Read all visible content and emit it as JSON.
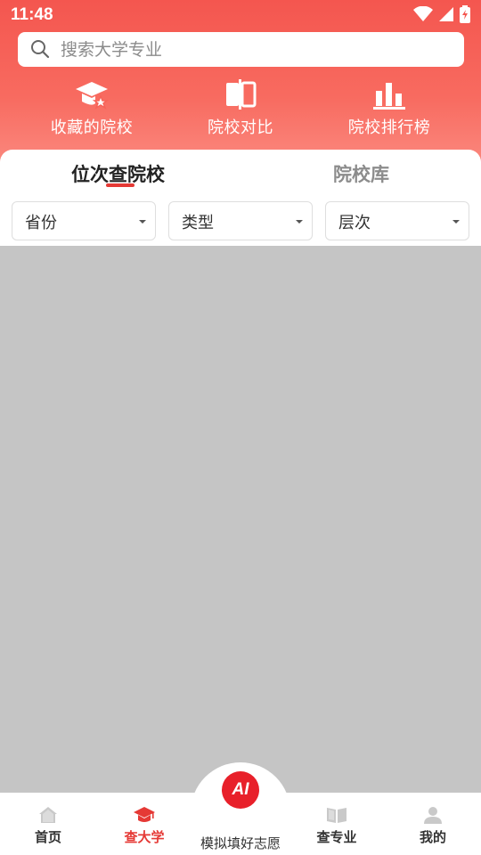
{
  "status_bar": {
    "time": "11:48"
  },
  "search": {
    "placeholder": "搜索大学专业",
    "value": ""
  },
  "quick_actions": [
    {
      "label": "收藏的院校",
      "icon": "graduation-star-icon"
    },
    {
      "label": "院校对比",
      "icon": "compare-icon"
    },
    {
      "label": "院校排行榜",
      "icon": "bar-ranking-icon"
    }
  ],
  "tabs": [
    {
      "label": "位次查院校",
      "active": true
    },
    {
      "label": "院校库",
      "active": false
    }
  ],
  "filters": [
    {
      "label": "省份"
    },
    {
      "label": "类型"
    },
    {
      "label": "层次"
    }
  ],
  "bottom_nav": {
    "items": [
      {
        "label": "首页",
        "icon": "home-icon",
        "active": false
      },
      {
        "label": "查大学",
        "icon": "graduation-cap-icon",
        "active": true
      },
      {
        "label": "查专业",
        "icon": "book-icon",
        "active": false
      },
      {
        "label": "我的",
        "icon": "user-icon",
        "active": false
      }
    ],
    "ai_button": {
      "text": "AI",
      "label": "模拟填好志愿"
    }
  },
  "colors": {
    "accent": "#e53935",
    "header": "#f4564f",
    "content_bg": "#c5c5c5"
  }
}
